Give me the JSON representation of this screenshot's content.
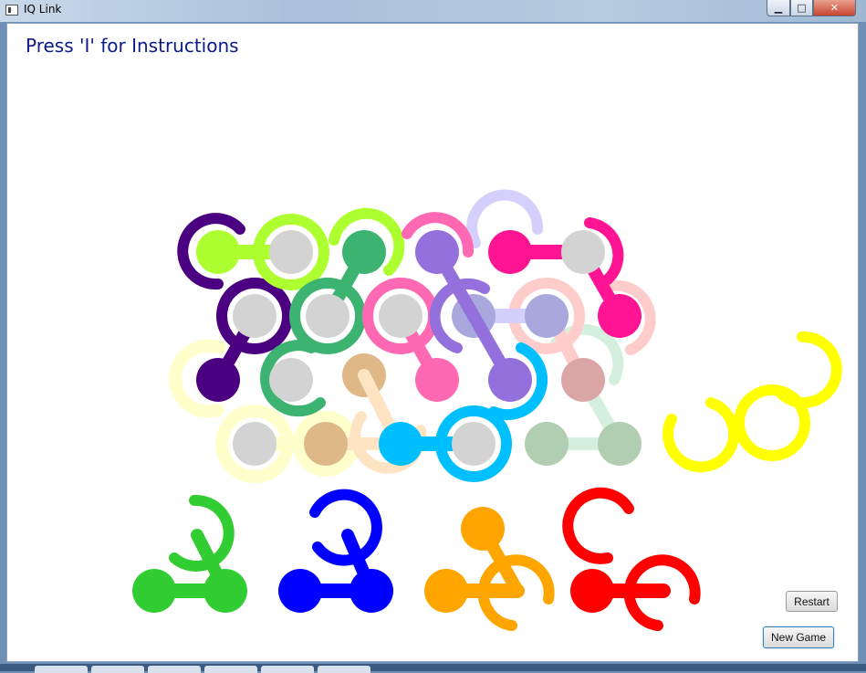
{
  "window": {
    "title": "IQ Link",
    "minimize": "▁",
    "maximize": "□",
    "close": "✕"
  },
  "instructions": "Press 'I' for Instructions",
  "buttons": {
    "restart": "Restart",
    "new_game": "New Game"
  },
  "colors": {
    "purple": "#4b0082",
    "lime": "#adff2f",
    "green_dark": "#3cb371",
    "pink": "#ff69b4",
    "orchid": "#9370db",
    "lavender": "#d4d0fb",
    "magenta": "#ff1493",
    "rose": "#ffcccc",
    "lightyellow": "#ffffcc",
    "tan": "#deb887",
    "wheat": "#ffe4c4",
    "sky": "#00bfff",
    "mint": "#d4f0dc",
    "sage": "#b2ceb2",
    "yellow": "#ffff00",
    "green": "#32cd32",
    "blue": "#0000ff",
    "orange": "#ffa500",
    "red": "#ff0000",
    "peg_gray": "#d3d3d3"
  }
}
